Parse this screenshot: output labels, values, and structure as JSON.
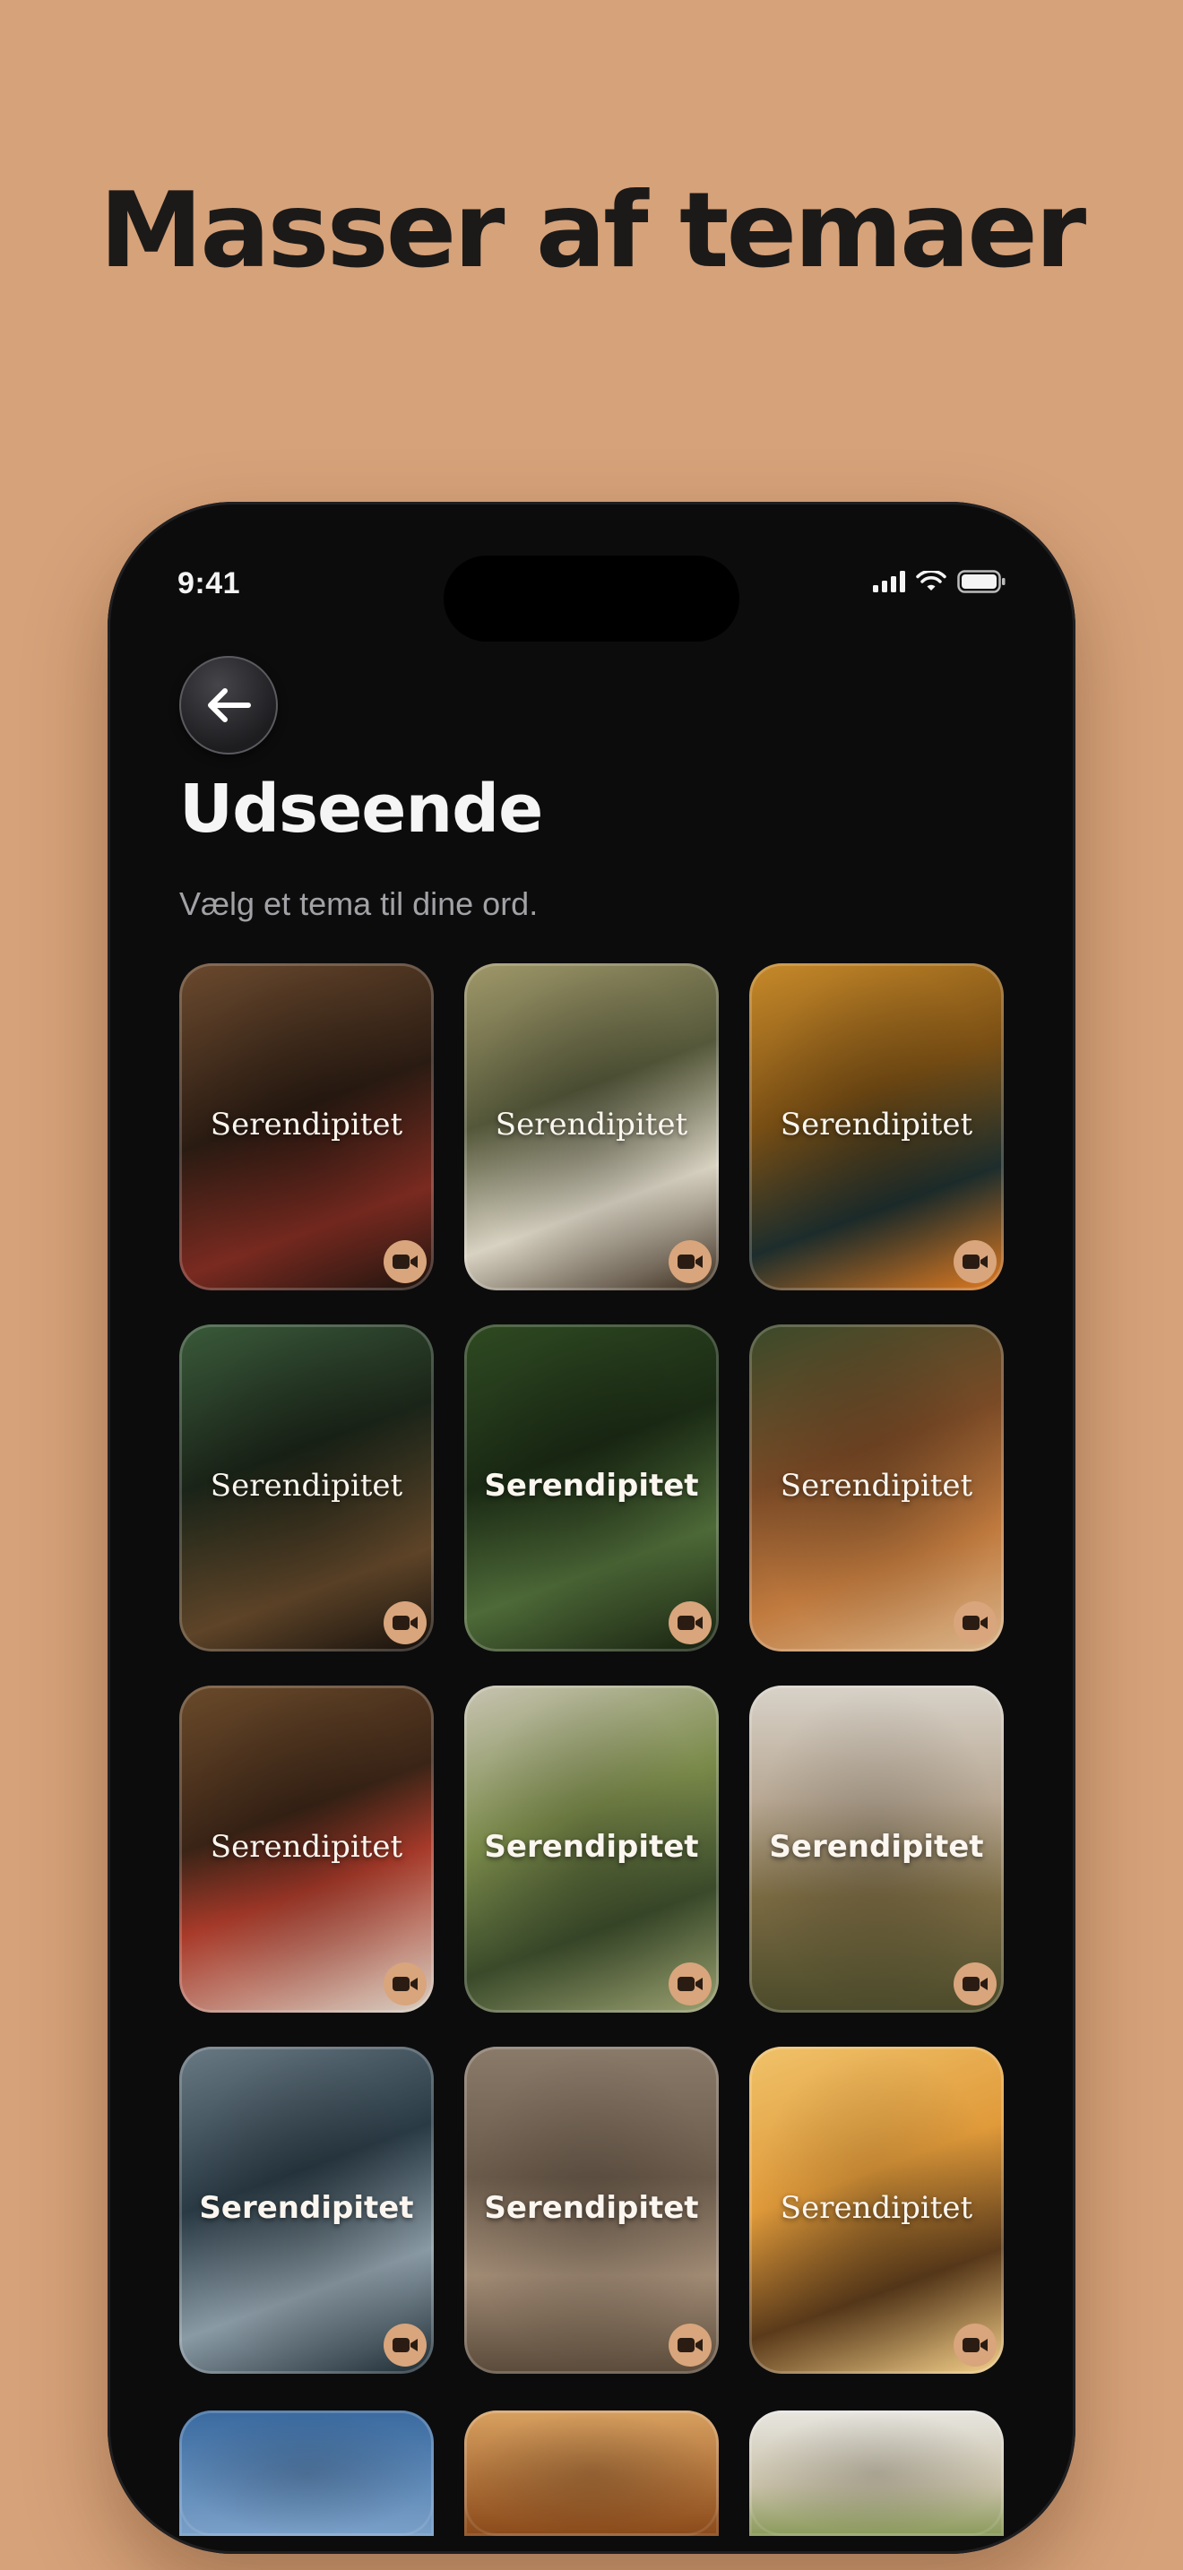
{
  "headline": "Masser af temaer",
  "status_bar": {
    "time": "9:41",
    "icons": [
      "cellular-signal-icon",
      "wifi-icon",
      "battery-icon"
    ]
  },
  "back_button": {
    "icon": "arrow-left-icon"
  },
  "screen": {
    "title": "Udseende",
    "subtitle": "Vælg et tema til dine ord."
  },
  "themes": [
    {
      "label": "Serendipitet",
      "style": "serif",
      "bg": "linear-gradient(160deg,#6b4a2e 0%,#2a1b12 45%,#7a2a20 75%,#1c140e 100%)",
      "badge_icon": "video-camera-icon"
    },
    {
      "label": "Serendipitet",
      "style": "serif",
      "bg": "linear-gradient(160deg,#a0986a 0%,#55583a 40%,#d8d2c2 70%,#3a2c1e 100%)",
      "badge_icon": "video-camera-icon"
    },
    {
      "label": "Serendipitet",
      "style": "serif",
      "bg": "linear-gradient(160deg,#c88a2a 0%,#7a4f14 40%,#1d2d2c 70%,#e07a20 100%)",
      "badge_icon": "video-camera-icon"
    },
    {
      "label": "Serendipitet",
      "style": "serif",
      "bg": "linear-gradient(160deg,#3a5a3a 0%,#1a2418 40%,#5e4428 75%,#140f0b 100%)",
      "badge_icon": "video-camera-icon"
    },
    {
      "label": "Serendipitet",
      "style": "sans",
      "bg": "linear-gradient(160deg,#2f4a22 0%,#1a2a14 40%,#4e6a38 70%,#16200f 100%)",
      "badge_icon": "video-camera-icon"
    },
    {
      "label": "Serendipitet",
      "style": "serif",
      "bg": "linear-gradient(160deg,#3a4a2a 0%,#7a4a26 40%,#c07a3e 70%,#d8b48a 100%)",
      "badge_icon": "video-camera-icon"
    },
    {
      "label": "Serendipitet",
      "style": "serif",
      "bg": "linear-gradient(160deg,#6a4a2a 0%,#3a2416 40%,#a83a2a 60%,#d8cfc2 100%)",
      "badge_icon": "video-camera-icon"
    },
    {
      "label": "Serendipitet",
      "style": "sans",
      "bg": "linear-gradient(160deg,#c8c4b2 0%,#7a8a4a 40%,#3a4a2a 70%,#9aa070 100%)",
      "badge_icon": "video-camera-icon"
    },
    {
      "label": "Serendipitet",
      "style": "sans",
      "bg": "linear-gradient(180deg,#d8d2c8 0%,#b8a894 35%,#7a6a42 65%,#4a4a2a 100%)",
      "badge_icon": "video-camera-icon"
    },
    {
      "label": "Serendipitet",
      "style": "sans",
      "bg": "linear-gradient(160deg,#6a7a84 0%,#2a3a44 40%,#8a9aa4 70%,#1c2a32 100%)",
      "badge_icon": "video-camera-icon"
    },
    {
      "label": "Serendipitet",
      "style": "sans",
      "bg": "linear-gradient(180deg,#8a7a6a 0%,#6a5a4a 40%,#a08a74 70%,#5a4a3a 100%)",
      "badge_icon": "video-camera-icon"
    },
    {
      "label": "Serendipitet",
      "style": "serif",
      "bg": "linear-gradient(160deg,#f0c26a 0%,#e09a3a 40%,#5a3a1a 70%,#f4d08a 100%)",
      "badge_icon": "video-camera-icon"
    }
  ],
  "partial_themes": [
    {
      "bg": "linear-gradient(180deg,#3a6aa0 0%,#7aa0c8 100%)"
    },
    {
      "bg": "linear-gradient(180deg,#d8a060 0%,#8a4a1a 100%)"
    },
    {
      "bg": "linear-gradient(180deg,#e8e6e0 0%,#c8c0a8 60%,#8a9a5a 100%)"
    }
  ],
  "colors": {
    "background": "#d6a27a",
    "phone": "#0c0c0d",
    "badge": "#d9a57c"
  }
}
